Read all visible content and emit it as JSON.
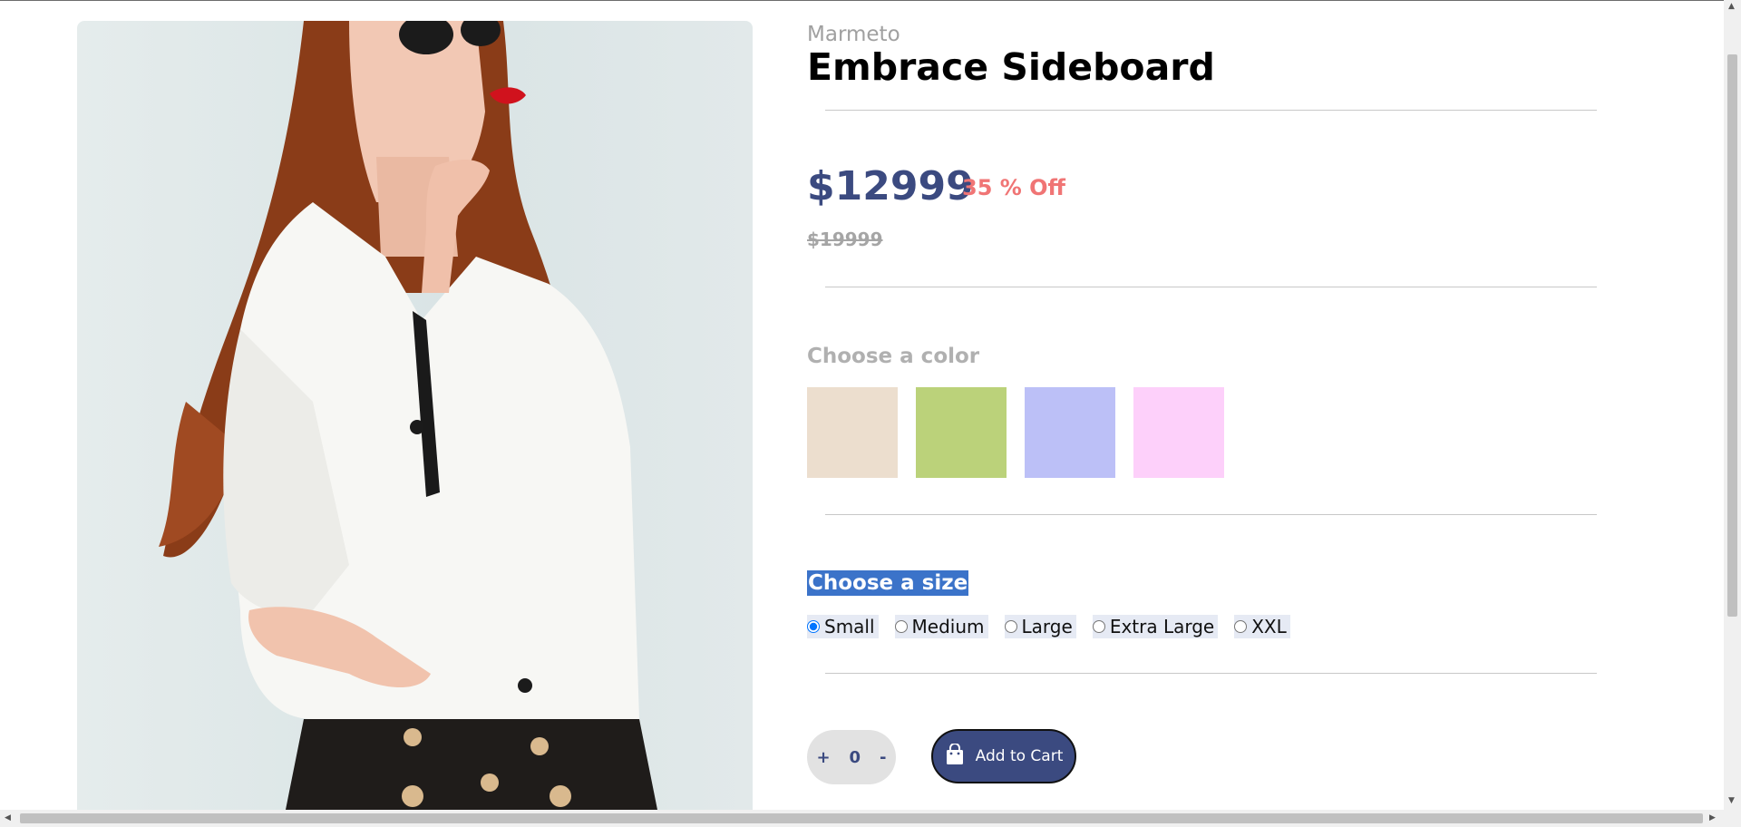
{
  "product": {
    "brand": "Marmeto",
    "title": "Embrace Sideboard",
    "price": "$12999",
    "discount": "35 % Off",
    "compare_price": "$19999",
    "image_alt": "woman in white shirt with sunglasses"
  },
  "color_section": {
    "label": "Choose a color",
    "swatches": [
      "#ecdece",
      "#bbd27a",
      "#bcc0f7",
      "#fdd0fa"
    ]
  },
  "size_section": {
    "label": "Choose a size",
    "options": [
      "Small",
      "Medium",
      "Large",
      "Extra Large",
      "XXL"
    ],
    "selected": "Small"
  },
  "quantity": {
    "plus": "+",
    "value": "0",
    "minus": "-"
  },
  "cart": {
    "button_label": "Add to Cart",
    "icon": "shopping-bag-icon"
  },
  "theme": {
    "accent": "#3b4a80",
    "discount_color": "#f07575"
  }
}
